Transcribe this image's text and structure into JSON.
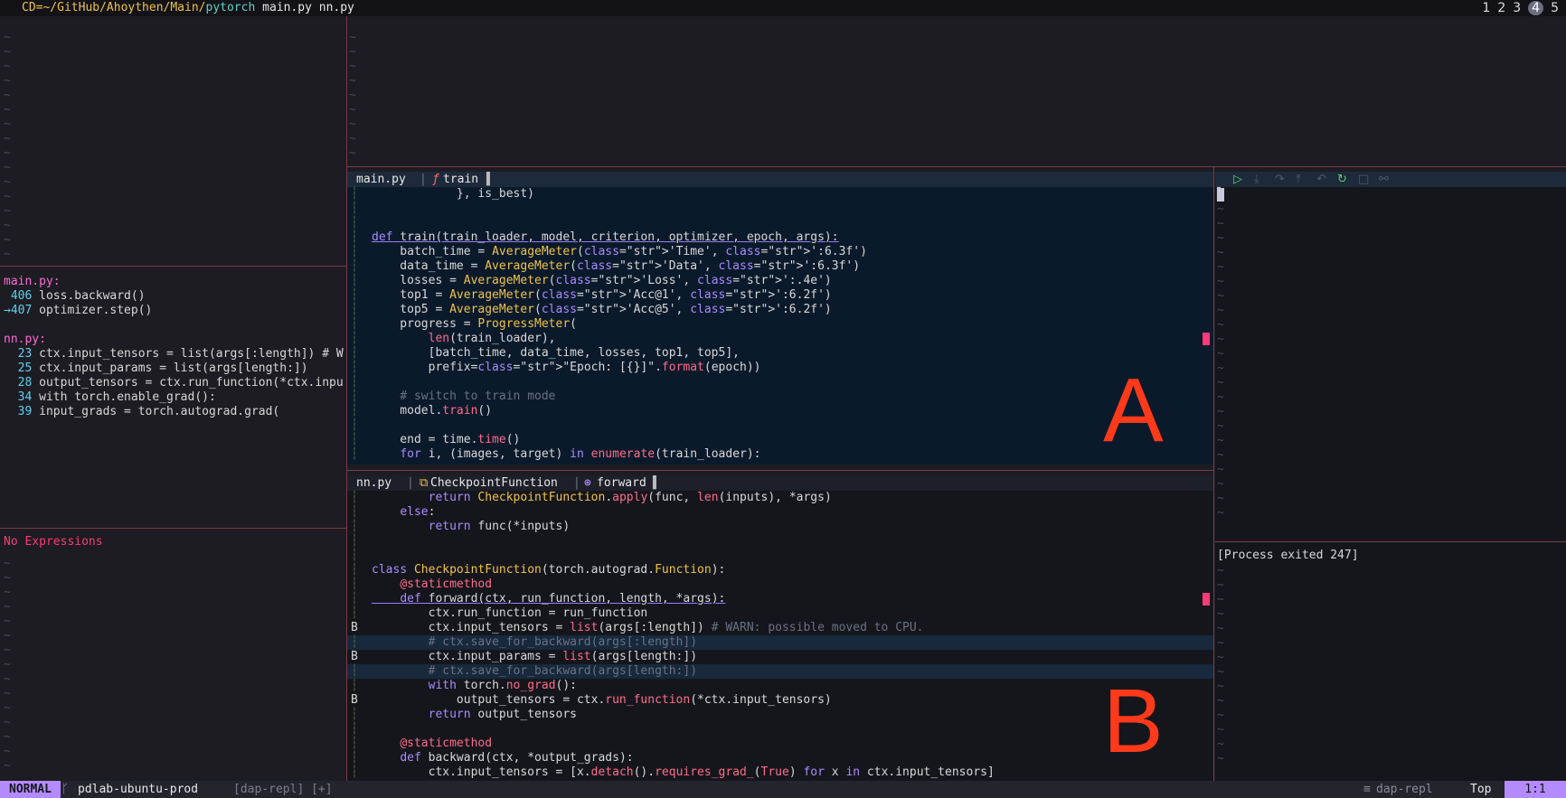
{
  "topbar": {
    "apple_icon": "apple-logo",
    "cd_prefix": "CD=~/GitHub/Ahoythen/Main/",
    "cd_dir": "pytorch",
    "open_files": " main.py nn.py",
    "workspaces": [
      "1",
      "2",
      "3",
      "4",
      "5"
    ],
    "active_workspace": "4"
  },
  "left": {
    "backtrace": {
      "files": [
        {
          "name": "main.py:",
          "lines": [
            {
              "num": " 406",
              "text": " loss.backward()"
            },
            {
              "num": "→407",
              "text": " optimizer.step()"
            }
          ]
        },
        {
          "name": "nn.py:",
          "lines": [
            {
              "num": "  23",
              "text": " ctx.input_tensors = list(args[:length]) # W"
            },
            {
              "num": "  25",
              "text": " ctx.input_params = list(args[length:])"
            },
            {
              "num": "  28",
              "text": " output_tensors = ctx.run_function(*ctx.inpu"
            },
            {
              "num": "  34",
              "text": " with torch.enable_grad():"
            },
            {
              "num": "  39",
              "text": " input_grads = torch.autograd.grad("
            }
          ]
        }
      ]
    },
    "expressions_empty": "No Expressions"
  },
  "paneA": {
    "label": "A",
    "winbar": {
      "file": "main.py",
      "func": "train"
    },
    "lines": [
      "            }, is_best)",
      "",
      "",
      "def train(train_loader, model, criterion, optimizer, epoch, args):",
      "    batch_time = AverageMeter('Time', ':6.3f')",
      "    data_time = AverageMeter('Data', ':6.3f')",
      "    losses = AverageMeter('Loss', ':.4e')",
      "    top1 = AverageMeter('Acc@1', ':6.2f')",
      "    top5 = AverageMeter('Acc@5', ':6.2f')",
      "    progress = ProgressMeter(",
      "        len(train_loader),",
      "        [batch_time, data_time, losses, top1, top5],",
      "        prefix=\"Epoch: [{}]\".format(epoch))",
      "",
      "    # switch to train mode",
      "    model.train()",
      "",
      "    end = time.time()",
      "    for i, (images, target) in enumerate(train_loader):"
    ]
  },
  "paneB": {
    "label": "B",
    "winbar": {
      "file": "nn.py",
      "cls": "CheckpointFunction",
      "method": "forward"
    },
    "gutter_marks": [
      "",
      "",
      "",
      "",
      "",
      "",
      "",
      "",
      "",
      "B",
      "",
      "B",
      "",
      "",
      "B",
      "",
      "",
      "",
      "",
      ""
    ],
    "lines": [
      "        return CheckpointFunction.apply(func, len(inputs), *args)",
      "    else:",
      "        return func(*inputs)",
      "",
      "",
      "class CheckpointFunction(torch.autograd.Function):",
      "    @staticmethod",
      "    def forward(ctx, run_function, length, *args):",
      "        ctx.run_function = run_function",
      "        ctx.input_tensors = list(args[:length]) # WARN: possible moved to CPU.",
      "        # ctx.save_for_backward(args[:length])",
      "        ctx.input_params = list(args[length:])",
      "        # ctx.save_for_backward(args[length:])",
      "        with torch.no_grad():",
      "            output_tensors = ctx.run_function(*ctx.input_tensors)",
      "        return output_tensors",
      "",
      "    @staticmethod",
      "    def backward(ctx, *output_grads):",
      "        ctx.input_tensors = [x.detach().requires_grad_(True) for x in ctx.input_tensors]"
    ]
  },
  "dap": {
    "controls": [
      "play-icon",
      "step-into-icon",
      "step-over-icon",
      "step-out-icon",
      "step-back-icon",
      "restart-icon",
      "stop-icon",
      "disconnect-icon"
    ],
    "repl_output": "[Process exited 247]"
  },
  "statusline": {
    "mode": "NORMAL",
    "branch": "pdlab-ubuntu-prod",
    "buffer": "[dap-repl] [+]",
    "filetype": "dap-repl",
    "scroll": "Top",
    "position": "1:1"
  },
  "colors": {
    "accent": "#b48bff",
    "label": "#ff3a1a",
    "border": "#7a3b4a"
  }
}
